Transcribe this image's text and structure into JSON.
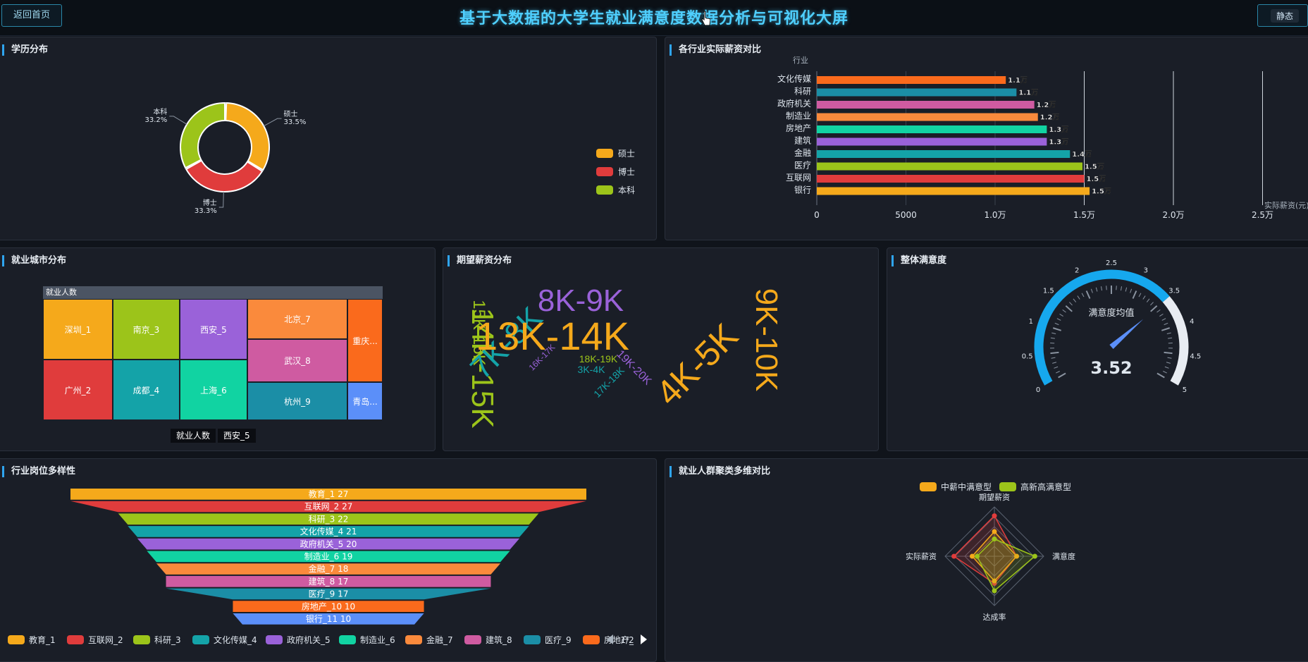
{
  "header": {
    "back": "返回首页",
    "title": "基于大数据的大学生就业满意度数据分析与可视化大屏",
    "static": "静态"
  },
  "panels": {
    "edu": "学历分布",
    "salary": "各行业实际薪资对比",
    "city": "就业城市分布",
    "expect": "期望薪资分布",
    "satis": "整体满意度",
    "industry": "行业岗位多样性",
    "cluster": "就业人群聚类多维对比"
  },
  "colors": {
    "accent": "#2fa5ef",
    "orange": "#f5a91b",
    "red": "#e03c3c",
    "green": "#9cc41a",
    "teal": "#14a3a8",
    "purple": "#9a62d9",
    "mint": "#11d3a2",
    "coral": "#fa8a3c",
    "pink": "#cf5ba1",
    "cyan": "#1b8ea6",
    "dorange": "#fa6a1c",
    "blue": "#5b8ff9",
    "gauge": "#16a8ee"
  },
  "chart_data": [
    {
      "type": "pie",
      "slices": [
        {
          "name": "硕士",
          "value": 33.5,
          "label": "33.5%",
          "color": "#f5a91b"
        },
        {
          "name": "博士",
          "value": 33.3,
          "label": "33.3%",
          "color": "#e03c3c"
        },
        {
          "name": "本科",
          "value": 33.2,
          "label": "33.2%",
          "color": "#9cc41a"
        }
      ],
      "legend": [
        "硕士",
        "博士",
        "本科"
      ]
    },
    {
      "type": "bar",
      "orientation": "horizontal",
      "ylabel": "行业",
      "xlabel": "实际薪资(元)",
      "categories": [
        "文化传媒",
        "科研",
        "政府机关",
        "制造业",
        "房地产",
        "建筑",
        "金融",
        "医疗",
        "互联网",
        "银行"
      ],
      "values": [
        10600,
        11200,
        12200,
        12400,
        12900,
        12900,
        14200,
        14900,
        15000,
        15300
      ],
      "labels": [
        "1.1万",
        "1.1万",
        "1.2万",
        "1.2万",
        "1.3万",
        "1.3万",
        "1.4万",
        "1.5万",
        "1.5万",
        "1.5万"
      ],
      "colors": [
        "#fa6a1c",
        "#1b8ea6",
        "#cf5ba1",
        "#fa8a3c",
        "#11d3a2",
        "#9a62d9",
        "#14a3a8",
        "#9cc41a",
        "#e03c3c",
        "#f5a91b"
      ],
      "xticks": [
        "0",
        "5000",
        "1.0万",
        "1.5万",
        "2.0万",
        "2.5万"
      ],
      "xlim": [
        0,
        25000
      ]
    },
    {
      "type": "treemap",
      "root": "就业人数",
      "breadcrumb": [
        "就业人数",
        "西安_5"
      ],
      "items": [
        "深圳_1",
        "南京_3",
        "西安_5",
        "北京_7",
        "重庆...",
        "广州_2",
        "成都_4",
        "上海_6",
        "武汉_8",
        "杭州_9",
        "青岛..."
      ]
    },
    {
      "type": "wordcloud",
      "words": [
        "14K-15K",
        "15K-16K",
        "7K-8K",
        "16K-17K",
        "8K-9K",
        "13K-14K",
        "18K-19K",
        "3K-4K",
        "17K-18K",
        "19K-20K",
        "4K-5K",
        "9K-10K"
      ]
    },
    {
      "type": "gauge",
      "label": "满意度均值",
      "value": 3.52,
      "display": "3.52",
      "min": 0,
      "max": 5,
      "ticks": [
        "0",
        "0.5",
        "1",
        "1.5",
        "2",
        "2.5",
        "3",
        "3.5",
        "4",
        "4.5",
        "5"
      ]
    },
    {
      "type": "funnel",
      "items": [
        {
          "label": "教育_1 27",
          "name": "教育_1",
          "value": 27,
          "color": "#f5a91b"
        },
        {
          "label": "互联网_2 27",
          "name": "互联网_2",
          "value": 27,
          "color": "#e03c3c"
        },
        {
          "label": "科研_3 22",
          "name": "科研_3",
          "value": 22,
          "color": "#9cc41a"
        },
        {
          "label": "文化传媒_4 21",
          "name": "文化传媒_4",
          "value": 21,
          "color": "#14a3a8"
        },
        {
          "label": "政府机关_5 20",
          "name": "政府机关_5",
          "value": 20,
          "color": "#9a62d9"
        },
        {
          "label": "制造业_6 19",
          "name": "制造业_6",
          "value": 19,
          "color": "#11d3a2"
        },
        {
          "label": "金融_7 18",
          "name": "金融_7",
          "value": 18,
          "color": "#fa8a3c"
        },
        {
          "label": "建筑_8 17",
          "name": "建筑_8",
          "value": 17,
          "color": "#cf5ba1"
        },
        {
          "label": "医疗_9 17",
          "name": "医疗_9",
          "value": 17,
          "color": "#1b8ea6"
        },
        {
          "label": "房地产_10 10",
          "name": "房地产_10",
          "value": 10,
          "color": "#fa6a1c"
        },
        {
          "label": "银行_11 10",
          "name": "银行_11",
          "value": 10,
          "color": "#5b8ff9"
        }
      ],
      "legend": [
        "教育_1",
        "互联网_2",
        "科研_3",
        "文化传媒_4",
        "政府机关_5",
        "制造业_6",
        "金融_7",
        "建筑_8",
        "医疗_9",
        "房地产_"
      ],
      "pager": "1/2"
    },
    {
      "type": "radar",
      "indicators": [
        "期望薪资",
        "满意度",
        "达成率",
        "实际薪资"
      ],
      "legend": [
        "中薪中满意型",
        "高新高满意型"
      ],
      "series": [
        {
          "name": "中薪中满意型",
          "values": [
            0.5,
            0.45,
            0.5,
            0.45
          ],
          "color": "#f5a91b"
        },
        {
          "name": "高新高满意型",
          "values": [
            0.35,
            0.82,
            0.7,
            0.35
          ],
          "color": "#9cc41a"
        }
      ],
      "extra_series_color": "#e03c3c",
      "extra_values": [
        0.82,
        0.45,
        0.55,
        0.82
      ]
    }
  ]
}
